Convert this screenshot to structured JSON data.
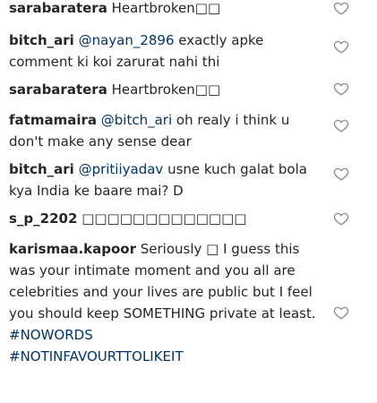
{
  "comments": [
    {
      "username": "sarabaratera",
      "text": "Heartbroken□□"
    },
    {
      "username": "bitch_ari",
      "mention": "@nayan_2896",
      "text": "exactly apke comment ki koi zarurat nahi thi"
    },
    {
      "username": "sarabaratera",
      "text": "Heartbroken□□"
    },
    {
      "username": "fatmamaira",
      "mention": "@bitch_ari",
      "text": "oh realy i think u don't make any sense dear"
    },
    {
      "username": "bitch_ari",
      "mention": "@pritiiyadav",
      "text": "usne kuch galat bola kya India ke baare mai? D"
    },
    {
      "username": "s_p_2202",
      "text": "□□□□□□□□□□□□□"
    },
    {
      "username": "karismaa.kapoor",
      "text": "Seriously □ I guess this was your intimate moment and you all are celebrities and your lives are public but I feel you should keep SOMETHING private at least.",
      "hashtags": [
        "#NOWORDS",
        "#NOTINFAVOURTTOLIKEIT"
      ]
    }
  ],
  "icons": {
    "like": "heart-outline-icon"
  },
  "colors": {
    "text": "#262626",
    "link": "#003569",
    "heart": "#8e8e8e"
  }
}
